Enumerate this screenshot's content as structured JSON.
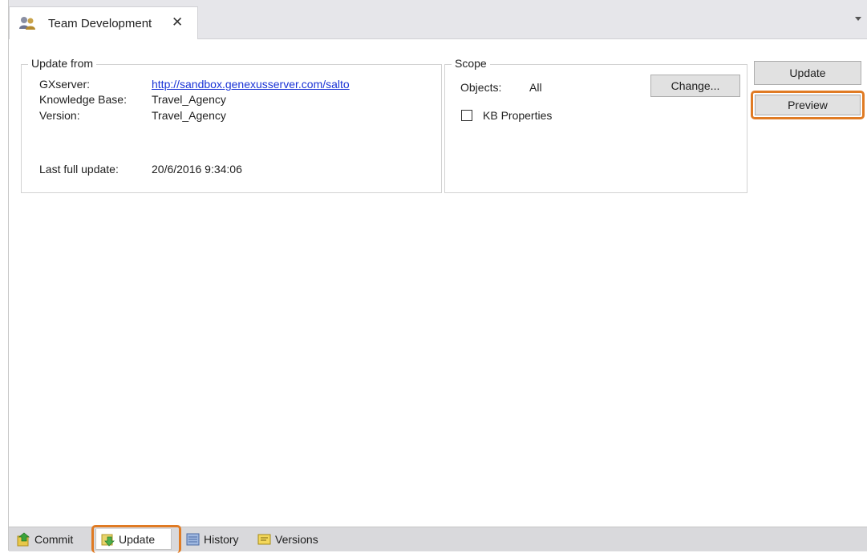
{
  "tab": {
    "title": "Team Development",
    "close": "✕"
  },
  "update_from": {
    "legend": "Update from",
    "gxserver_label": "GXserver:",
    "gxserver_value": "http://sandbox.genexusserver.com/salto",
    "kb_label": "Knowledge Base:",
    "kb_value": "Travel_Agency",
    "version_label": "Version:",
    "version_value": "Travel_Agency",
    "last_update_label": "Last full update:",
    "last_update_value": "20/6/2016 9:34:06"
  },
  "scope": {
    "legend": "Scope",
    "objects_label": "Objects:",
    "objects_value": "All",
    "change_button": "Change...",
    "kb_properties_label": "KB Properties",
    "kb_properties_checked": false
  },
  "actions": {
    "update": "Update",
    "preview": "Preview"
  },
  "bottom_tabs": [
    {
      "label": "Commit",
      "icon": "commit-icon",
      "active": false
    },
    {
      "label": "Update",
      "icon": "update-icon",
      "active": true
    },
    {
      "label": "History",
      "icon": "history-icon",
      "active": false
    },
    {
      "label": "Versions",
      "icon": "versions-icon",
      "active": false
    }
  ],
  "colors": {
    "highlight": "#e07b24",
    "link": "#1a33d6"
  }
}
